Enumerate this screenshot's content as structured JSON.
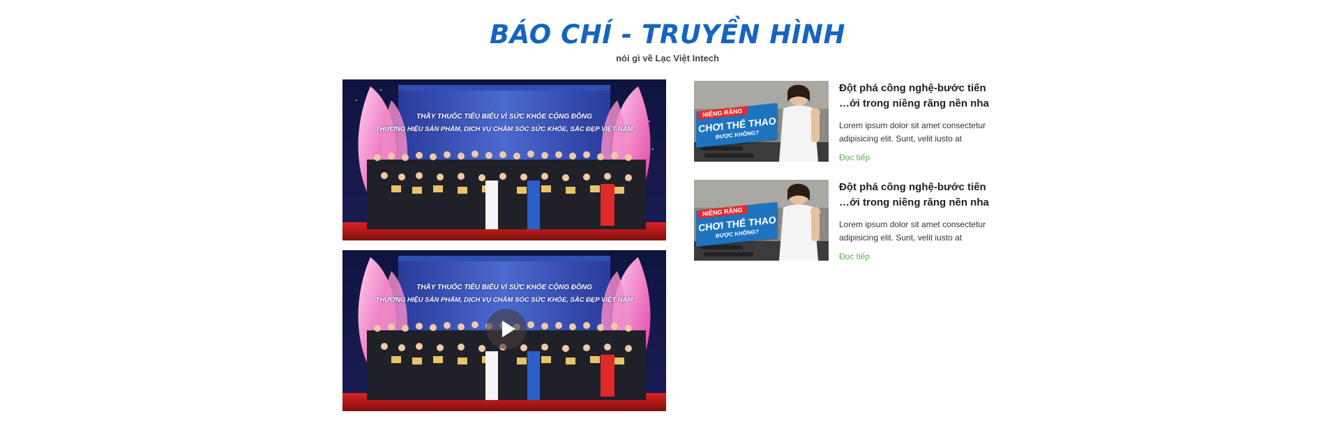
{
  "section": {
    "title": "BÁO CHÍ - TRUYỀN HÌNH",
    "subtitle": "nói gì về Lạc Việt Intech",
    "title_color": "#1565c0"
  },
  "videos": [
    {
      "banner_line1": "Thầy thuốc tiêu biểu vì sức khỏe cộng đồng",
      "banner_line2": "Thương hiệu sản phẩm, dịch vụ chăm sóc sức khỏe, sắc đẹp Việt Nam",
      "has_play_button": false
    },
    {
      "banner_line1": "Thầy thuốc tiêu biểu vì sức khỏe cộng đồng",
      "banner_line2": "Thương hiệu sản phẩm, dịch vụ chăm sóc sức khỏe, sắc đẹp Việt Nam",
      "has_play_button": true,
      "play_icon": "play-icon"
    }
  ],
  "news": [
    {
      "thumb_top": "NIỀNG RĂNG",
      "thumb_main": "CHƠI THỂ THAO",
      "thumb_sub": "ĐƯỢC KHÔNG?",
      "title_line1": "Đột phá công nghệ-bước tiến",
      "title_line2": "…ới trong niềng răng nền nha",
      "excerpt_line1": "Lorem ipsum dolor sit amet consectetur",
      "excerpt_line2": "adipisicing elit. Sunt, velit iusto at",
      "read_more": "Đọc tiếp"
    },
    {
      "thumb_top": "NIỀNG RĂNG",
      "thumb_main": "CHƠI THỂ THAO",
      "thumb_sub": "ĐƯỢC KHÔNG?",
      "title_line1": "Đột phá công nghệ-bước tiến",
      "title_line2": "…ới trong niềng răng nền nha",
      "excerpt_line1": "Lorem ipsum dolor sit amet consectetur",
      "excerpt_line2": "adipisicing elit. Sunt, velit iusto at",
      "read_more": "Đọc tiếp"
    }
  ],
  "colors": {
    "accent": "#1565c0",
    "link": "#5cae4e",
    "text": "#222222"
  }
}
